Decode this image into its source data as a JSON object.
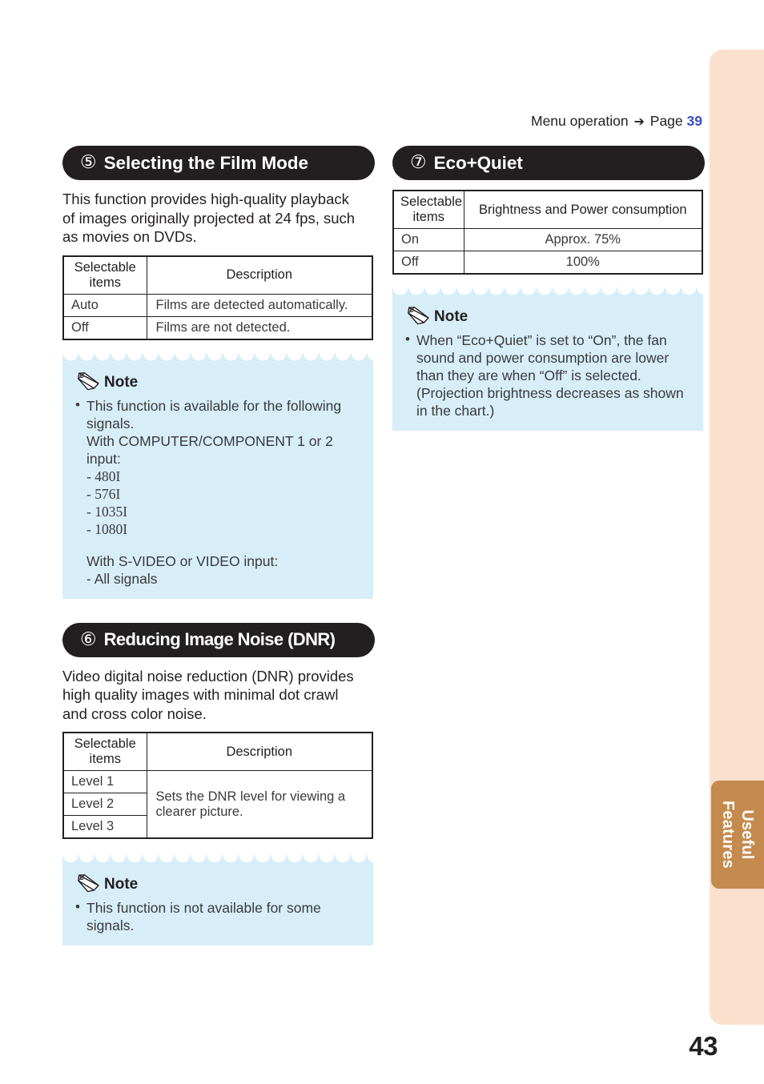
{
  "page": {
    "number": "43",
    "menu_operation": {
      "label": "Menu operation",
      "arrow": "➔",
      "page_label": "Page",
      "page_ref": "39"
    },
    "side_tab": {
      "line1": "Useful",
      "line2": "Features",
      "color": "#c48a4e"
    },
    "band_color": "#fbe0cd",
    "accent_link_color": "#3b4ec2"
  },
  "sections": {
    "film_mode": {
      "number": "⑤",
      "title": "Selecting the Film Mode",
      "intro": "This function provides high-quality playback of images originally projected at 24 fps, such as movies on DVDs.",
      "table": {
        "headers": [
          "Selectable items",
          "Description"
        ],
        "header_line1": "Selectable",
        "header_line2": "items",
        "rows": [
          {
            "item": "Auto",
            "desc": "Films are detected automatically."
          },
          {
            "item": "Off",
            "desc": "Films are not detected."
          }
        ]
      },
      "note": {
        "label": "Note",
        "lines": [
          "This function is available for the following",
          "signals.",
          "With COMPUTER/COMPONENT 1 or 2 input:",
          "- 480I",
          "- 576I",
          "- 1035I",
          "- 1080I",
          "With S-VIDEO or VIDEO input:",
          "- All signals"
        ]
      }
    },
    "dnr": {
      "number": "⑥",
      "title": "Reducing Image Noise (DNR)",
      "intro": "Video digital noise reduction (DNR) provides high quality images with minimal dot crawl and cross color noise.",
      "table": {
        "headers": [
          "Selectable items",
          "Description"
        ],
        "header_line1": "Selectable",
        "header_line2": "items",
        "items": [
          "Level 1",
          "Level 2",
          "Level 3"
        ],
        "description": "Sets the DNR level for viewing a clearer picture."
      },
      "note": {
        "label": "Note",
        "lines": [
          "This function is not available for some signals."
        ]
      }
    },
    "eco_quiet": {
      "number": "⑦",
      "title": "Eco+Quiet",
      "table": {
        "headers": [
          "Selectable items",
          "Brightness and Power consumption"
        ],
        "header_line1": "Selectable",
        "header_line2": "items",
        "rows": [
          {
            "item": "On",
            "value": "Approx. 75%"
          },
          {
            "item": "Off",
            "value": "100%"
          }
        ]
      },
      "note": {
        "label": "Note",
        "lines": [
          "When “Eco+Quiet” is set to “On”, the fan sound and power consumption are lower than they are when “Off” is selected. (Projection brightness decreases as shown in the chart.)"
        ]
      }
    }
  },
  "icons": {
    "note_icon": "pencil-icon",
    "arrow_icon": "right-arrow-icon"
  }
}
